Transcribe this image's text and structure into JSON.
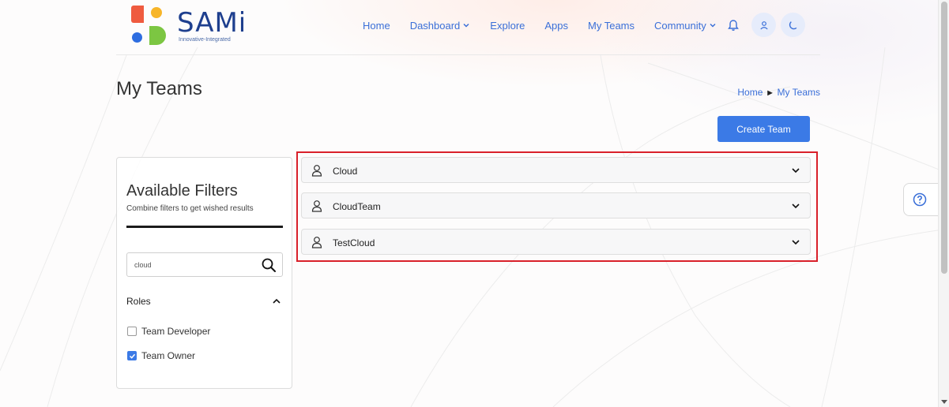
{
  "brand": {
    "name": "SAMi",
    "tagline": "Innovative-Integrated"
  },
  "nav": {
    "items": [
      "Home",
      "Dashboard",
      "Explore",
      "Apps",
      "My Teams",
      "Community"
    ]
  },
  "page": {
    "title": "My Teams"
  },
  "breadcrumb": {
    "home": "Home",
    "current": "My Teams"
  },
  "actions": {
    "create_team": "Create Team"
  },
  "filters": {
    "title": "Available Filters",
    "subtitle": "Combine filters to get wished results",
    "search_value": "cloud",
    "roles_label": "Roles",
    "roles": [
      {
        "label": "Team Developer",
        "checked": false
      },
      {
        "label": "Team Owner",
        "checked": true
      }
    ]
  },
  "teams": [
    {
      "name": "Cloud"
    },
    {
      "name": "CloudTeam"
    },
    {
      "name": "TestCloud"
    }
  ],
  "colors": {
    "accent": "#3b7ae6",
    "link": "#3a6fd8",
    "highlight": "#d9202a"
  }
}
